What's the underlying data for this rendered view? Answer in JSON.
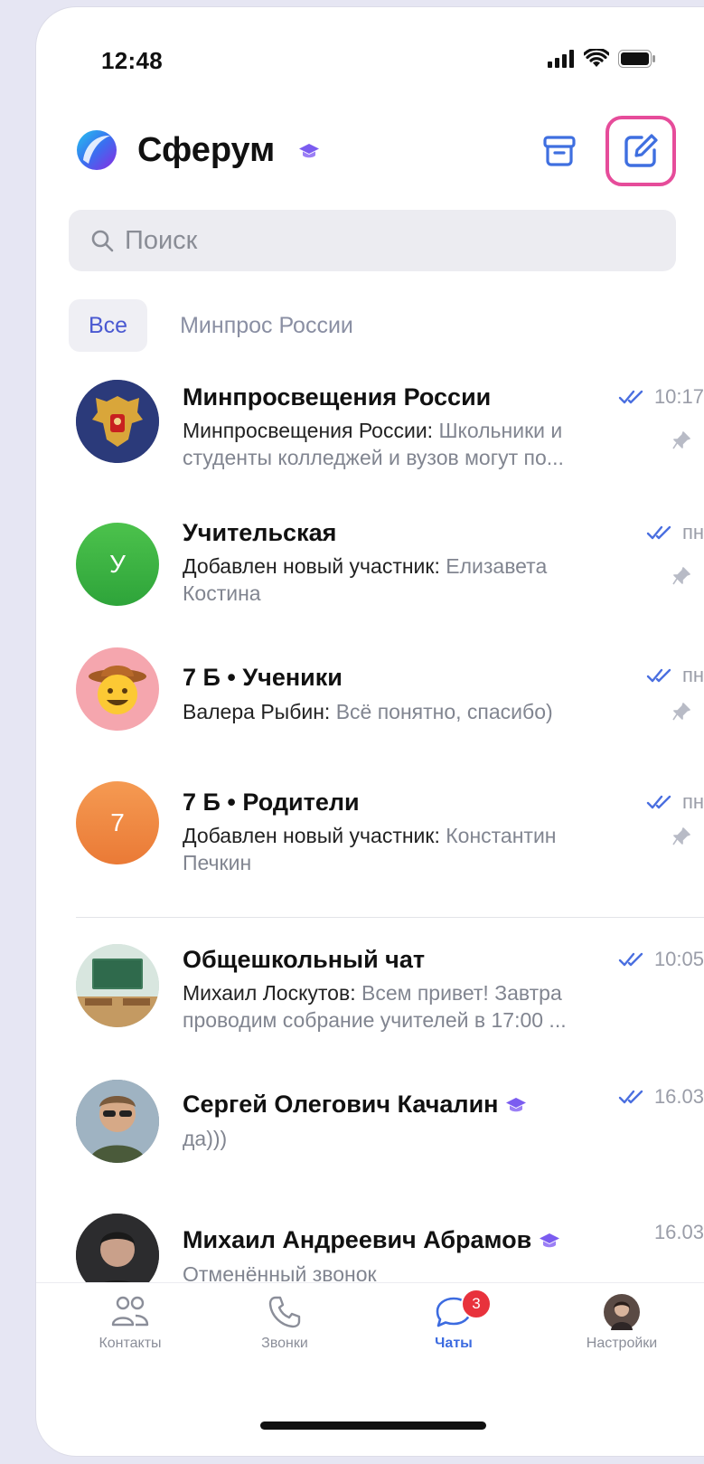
{
  "status_bar": {
    "time": "12:48"
  },
  "header": {
    "title": "Сферум"
  },
  "search": {
    "placeholder": "Поиск"
  },
  "filters": {
    "all": "Все",
    "minpros": "Минпрос России"
  },
  "colors": {
    "accent": "#4a59d1",
    "highlight": "#e64c9a",
    "badge": "#e8323c"
  },
  "chats": [
    {
      "name": "Минпросвещения России",
      "time": "10:17",
      "sender": "Минпросвещения России:",
      "text": " Школьники и студенты колледжей и вузов могут по...",
      "pinned": true,
      "read": true
    },
    {
      "name": "Учительская",
      "time": "пн",
      "sender": "Добавлен новый участник:",
      "text": " Елизавета Костина",
      "pinned": true,
      "read": true,
      "avatar_letter": "У"
    },
    {
      "name": "7 Б • Ученики",
      "time": "пн",
      "sender": "Валера Рыбин:",
      "text": " Всё понятно, спасибо)",
      "pinned": true,
      "read": true
    },
    {
      "name": "7 Б • Родители",
      "time": "пн",
      "sender": "Добавлен новый участник:",
      "text": " Константин Печкин",
      "pinned": true,
      "read": true,
      "avatar_letter": "7"
    },
    {
      "name": "Общешкольный чат",
      "time": "10:05",
      "sender": "Михаил Лоскутов:",
      "text": " Всем привет! Завтра проводим собрание учителей в 17:00 ...",
      "read": true
    },
    {
      "name": "Сергей Олегович Качалин",
      "time": "16.03",
      "text": "да)))",
      "read": true
    },
    {
      "name": "Михаил Андреевич Абрамов",
      "time": "16.03",
      "text": "Отменённый звонок"
    }
  ],
  "tabbar": {
    "contacts": "Контакты",
    "calls": "Звонки",
    "chats": "Чаты",
    "settings": "Настройки",
    "chats_badge": "3"
  }
}
